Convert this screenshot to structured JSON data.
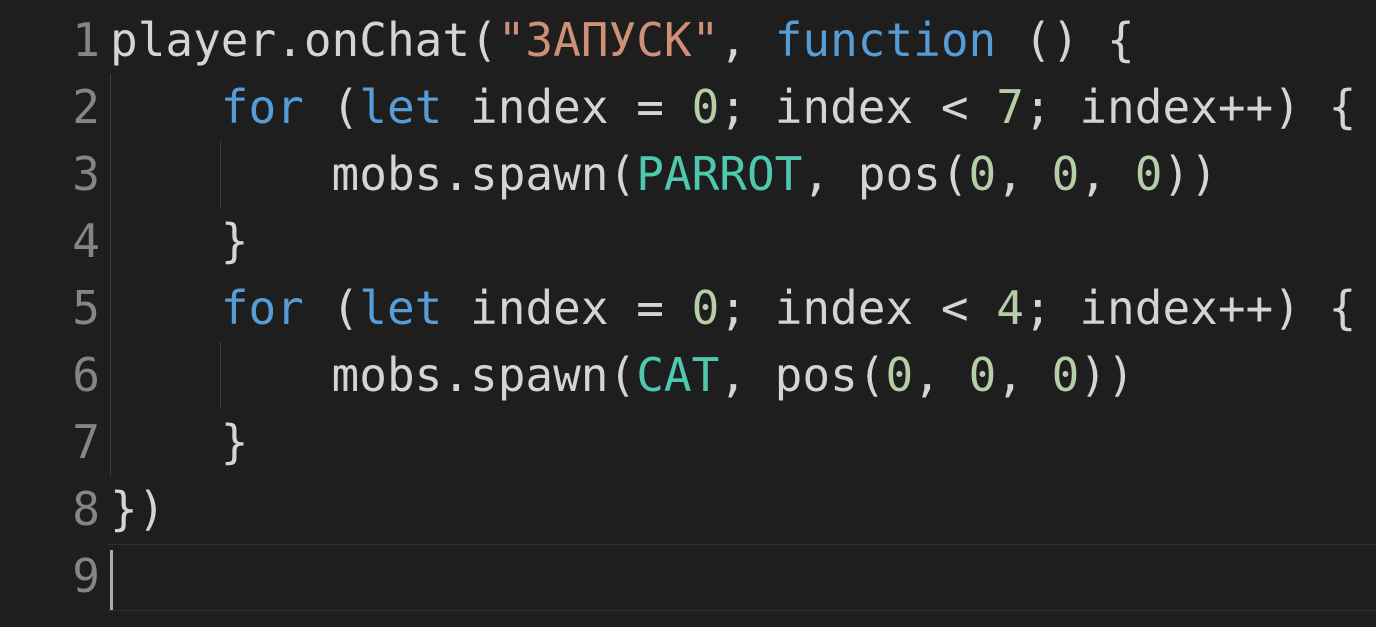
{
  "editor": {
    "line_numbers": [
      "1",
      "2",
      "3",
      "4",
      "5",
      "6",
      "7",
      "8",
      "9"
    ],
    "lines": [
      {
        "tokens": [
          {
            "t": "player.onChat(",
            "c": "ident"
          },
          {
            "t": "\"ЗАПУСК\"",
            "c": "str"
          },
          {
            "t": ", ",
            "c": "punc"
          },
          {
            "t": "function",
            "c": "kw"
          },
          {
            "t": " () {",
            "c": "punc"
          }
        ]
      },
      {
        "tokens": [
          {
            "t": "    ",
            "c": "punc"
          },
          {
            "t": "for",
            "c": "kw"
          },
          {
            "t": " (",
            "c": "punc"
          },
          {
            "t": "let",
            "c": "kw"
          },
          {
            "t": " index = ",
            "c": "ident"
          },
          {
            "t": "0",
            "c": "num"
          },
          {
            "t": "; index < ",
            "c": "ident"
          },
          {
            "t": "7",
            "c": "num"
          },
          {
            "t": "; index++) {",
            "c": "ident"
          }
        ]
      },
      {
        "tokens": [
          {
            "t": "        mobs.spawn(",
            "c": "ident"
          },
          {
            "t": "PARROT",
            "c": "enum"
          },
          {
            "t": ", pos(",
            "c": "ident"
          },
          {
            "t": "0",
            "c": "num"
          },
          {
            "t": ", ",
            "c": "punc"
          },
          {
            "t": "0",
            "c": "num"
          },
          {
            "t": ", ",
            "c": "punc"
          },
          {
            "t": "0",
            "c": "num"
          },
          {
            "t": "))",
            "c": "punc"
          }
        ]
      },
      {
        "tokens": [
          {
            "t": "    }",
            "c": "punc"
          }
        ]
      },
      {
        "tokens": [
          {
            "t": "    ",
            "c": "punc"
          },
          {
            "t": "for",
            "c": "kw"
          },
          {
            "t": " (",
            "c": "punc"
          },
          {
            "t": "let",
            "c": "kw"
          },
          {
            "t": " index = ",
            "c": "ident"
          },
          {
            "t": "0",
            "c": "num"
          },
          {
            "t": "; index < ",
            "c": "ident"
          },
          {
            "t": "4",
            "c": "num"
          },
          {
            "t": "; index++) {",
            "c": "ident"
          }
        ]
      },
      {
        "tokens": [
          {
            "t": "        mobs.spawn(",
            "c": "ident"
          },
          {
            "t": "CAT",
            "c": "enum"
          },
          {
            "t": ", pos(",
            "c": "ident"
          },
          {
            "t": "0",
            "c": "num"
          },
          {
            "t": ", ",
            "c": "punc"
          },
          {
            "t": "0",
            "c": "num"
          },
          {
            "t": ", ",
            "c": "punc"
          },
          {
            "t": "0",
            "c": "num"
          },
          {
            "t": "))",
            "c": "punc"
          }
        ]
      },
      {
        "tokens": [
          {
            "t": "    }",
            "c": "punc"
          }
        ]
      },
      {
        "tokens": [
          {
            "t": "})",
            "c": "punc"
          }
        ]
      },
      {
        "tokens": []
      }
    ]
  },
  "colors": {
    "background": "#1e1e1e",
    "keyword": "#569cd6",
    "string": "#ce9178",
    "number": "#b5cea8",
    "enum_member": "#4ec9b0",
    "text": "#d4d4d4",
    "line_number": "#858585"
  }
}
